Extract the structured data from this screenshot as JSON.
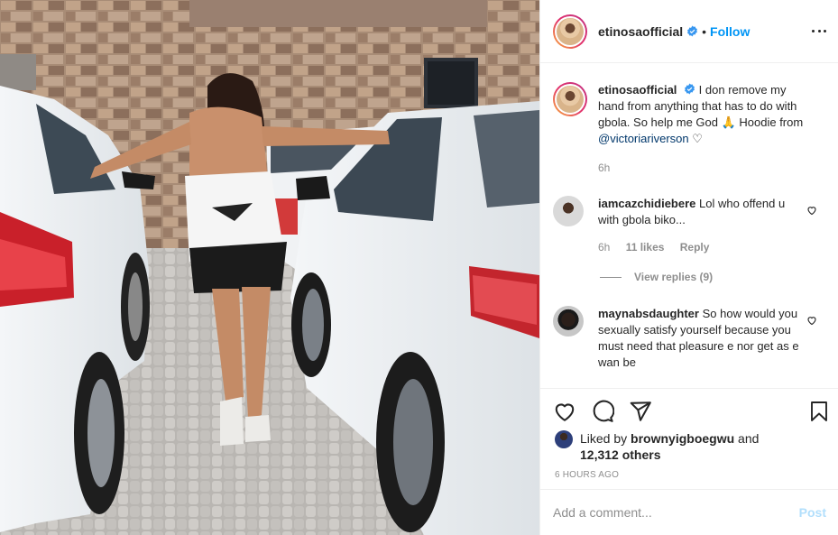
{
  "post": {
    "username": "etinosaofficial",
    "follow_label": "Follow",
    "separator": "•",
    "more_icon": "more-horizontal-icon",
    "caption": {
      "username": "etinosaofficial",
      "text_1": "I don remove my hand from anything that has to do with gbola. So help me God 🙏 Hoodie from ",
      "mention": "@victoriariverson",
      "text_2": " ♡",
      "time": "6h"
    },
    "comments": [
      {
        "username": "iamcazchidiebere",
        "text": "Lol who offend u with gbola biko...",
        "time": "6h",
        "likes": "11 likes",
        "reply": "Reply",
        "view_replies": "View replies (9)"
      },
      {
        "username": "maynabsdaughter",
        "text": "So how would you sexually satisfy yourself because you must need that pleasure e nor get as e wan be"
      }
    ],
    "actions": {
      "like_icon": "heart-icon",
      "comment_icon": "comment-icon",
      "share_icon": "share-icon",
      "save_icon": "bookmark-icon"
    },
    "liked_by": {
      "prefix": "Liked by ",
      "user": "brownyigboegwu",
      "middle": " and",
      "others": "12,312 others"
    },
    "timestamp": "6 HOURS AGO",
    "add_comment_placeholder": "Add a comment...",
    "post_button": "Post"
  },
  "colors": {
    "accent": "#0095f6",
    "post_disabled": "#b2dffc",
    "mention": "#00376b",
    "muted": "#8e8e8e"
  }
}
